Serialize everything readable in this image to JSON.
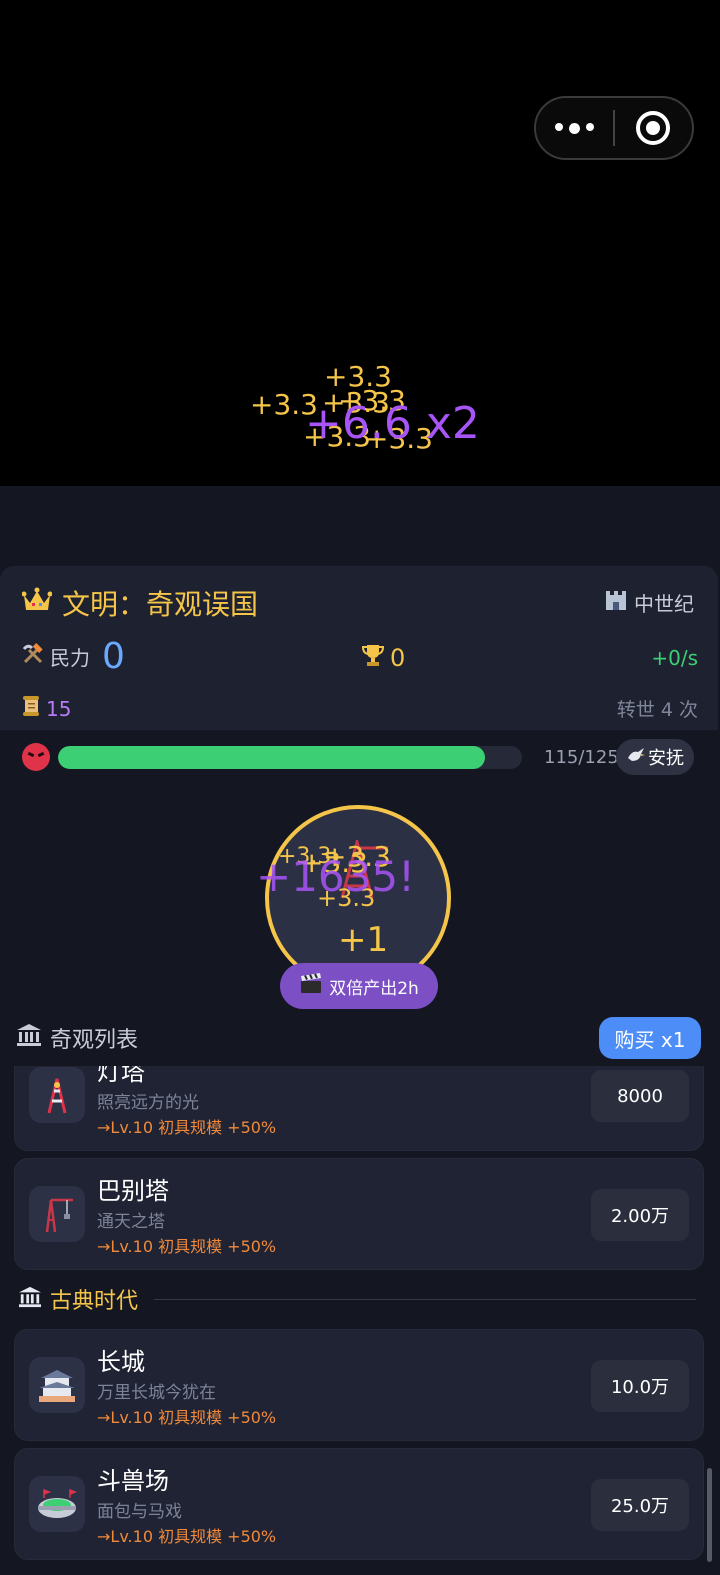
{
  "capsule": {
    "menu_icon": "more-dots-icon",
    "close_icon": "target-circle-icon"
  },
  "floating_texts": [
    "+3.3",
    "+3.3",
    "+3.3",
    "+3.3",
    "+3.3",
    "+3.3",
    "+6.6 x2"
  ],
  "header": {
    "title": "文明：奇观误国",
    "era": "中世纪",
    "power_label": "民力",
    "power_value": "0",
    "trophy_value": "0",
    "rate": "+0/s",
    "scroll_value": "15",
    "reincarnation": "转世 4 次"
  },
  "anger": {
    "current": 115,
    "max": 125,
    "text": "115/125",
    "fraction": 0.92,
    "pacify_label": "安抚"
  },
  "tap": {
    "texts": [
      "+3.3",
      "+3.3",
      "+3.3",
      "+3.3",
      "+1",
      "+1635!"
    ],
    "double_label": "双倍产出2h"
  },
  "list": {
    "title": "奇观列表",
    "buy_label": "购买 x1",
    "items": [
      {
        "name": "灯塔",
        "desc": "照亮远方的光",
        "bonus": "→Lv.10 初具规模 +50%",
        "price": "8000",
        "icon": "tower-icon"
      },
      {
        "name": "巴别塔",
        "desc": "通天之塔",
        "bonus": "→Lv.10 初具规模 +50%",
        "price": "2.00万",
        "icon": "crane-icon"
      },
      {
        "name": "长城",
        "desc": "万里长城今犹在",
        "bonus": "→Lv.10 初具规模 +50%",
        "price": "10.0万",
        "icon": "castle-icon"
      },
      {
        "name": "斗兽场",
        "desc": "面包与马戏",
        "bonus": "→Lv.10 初具规模 +50%",
        "price": "25.0万",
        "icon": "stadium-icon"
      }
    ],
    "section_title": "古典时代"
  },
  "colors": {
    "accent_gold": "#f5c54a",
    "accent_blue": "#4d8df7",
    "progress_green": "#3ccf74",
    "ad_purple": "#7c4fc4"
  }
}
